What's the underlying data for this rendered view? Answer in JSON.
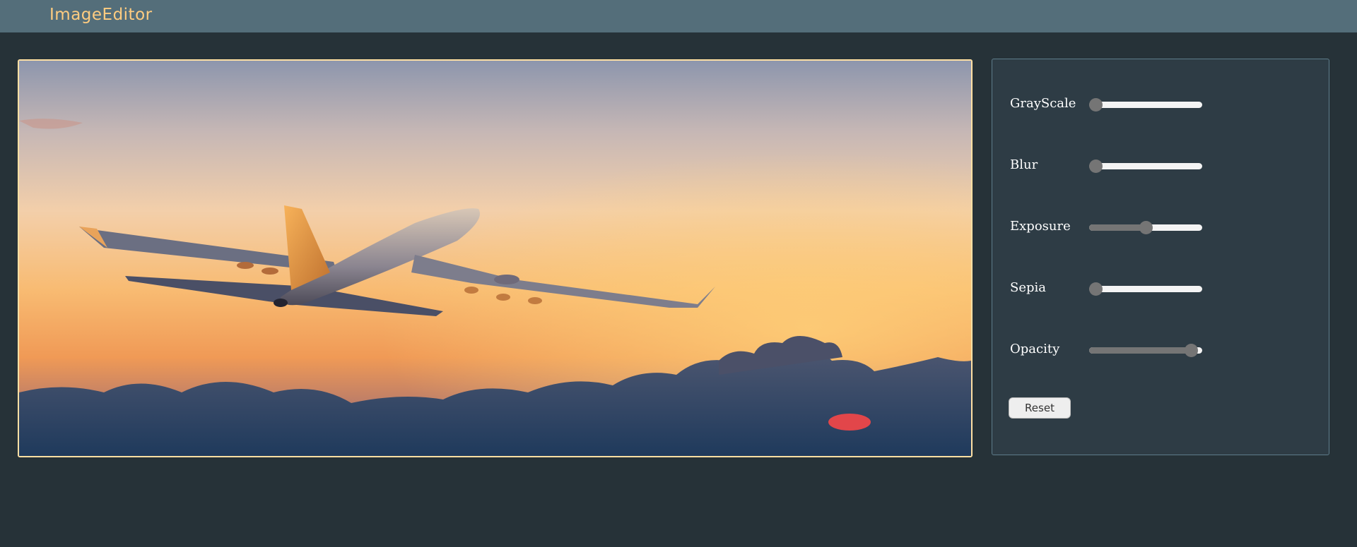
{
  "header": {
    "brand": "ImageEditor"
  },
  "colors": {
    "header_bg": "#546e7a",
    "brand": "#ffcc80",
    "page_bg": "#263238",
    "panel_bg": "#2e3c45",
    "image_border": "#ffe0a3"
  },
  "image": {
    "description_icon": "airplane-sunset-photo"
  },
  "controls": [
    {
      "label": "GrayScale",
      "value": 0
    },
    {
      "label": "Blur",
      "value": 0
    },
    {
      "label": "Exposure",
      "value": 50
    },
    {
      "label": "Sepia",
      "value": 0
    },
    {
      "label": "Opacity",
      "value": 95
    }
  ],
  "reset_label": "Reset"
}
